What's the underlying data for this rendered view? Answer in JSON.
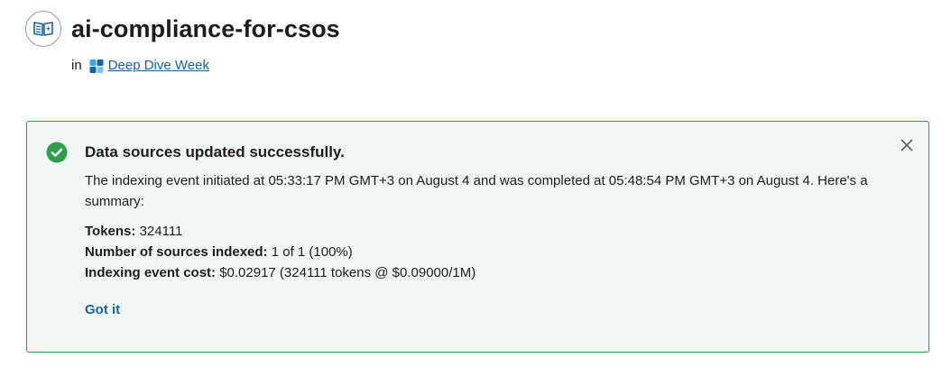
{
  "header": {
    "icon": "knowledge-base-book-icon",
    "title": "ai-compliance-for-csos"
  },
  "breadcrumb": {
    "in_label": "in",
    "project_icon": "project-squares-icon",
    "project_name": "Deep Dive Week"
  },
  "alert": {
    "status_icon": "check-circle-icon",
    "close_icon": "close-icon",
    "title": "Data sources updated successfully.",
    "description": "The indexing event initiated at 05:33:17 PM GMT+3 on August 4 and was completed at 05:48:54 PM GMT+3 on August 4. Here's a summary:",
    "summary": [
      {
        "label": "Tokens:",
        "value": " 324111"
      },
      {
        "label": "Number of sources indexed:",
        "value": " 1 of 1 (100%)"
      },
      {
        "label": "Indexing event cost:",
        "value": " $0.02917 (324111 tokens @ $0.09000/1M)"
      }
    ],
    "action_label": "Got it"
  },
  "colors": {
    "success": "#2e9e4a",
    "alert_background": "#f1f7f5",
    "link": "#1264a3",
    "text": "#1d1c1d"
  }
}
